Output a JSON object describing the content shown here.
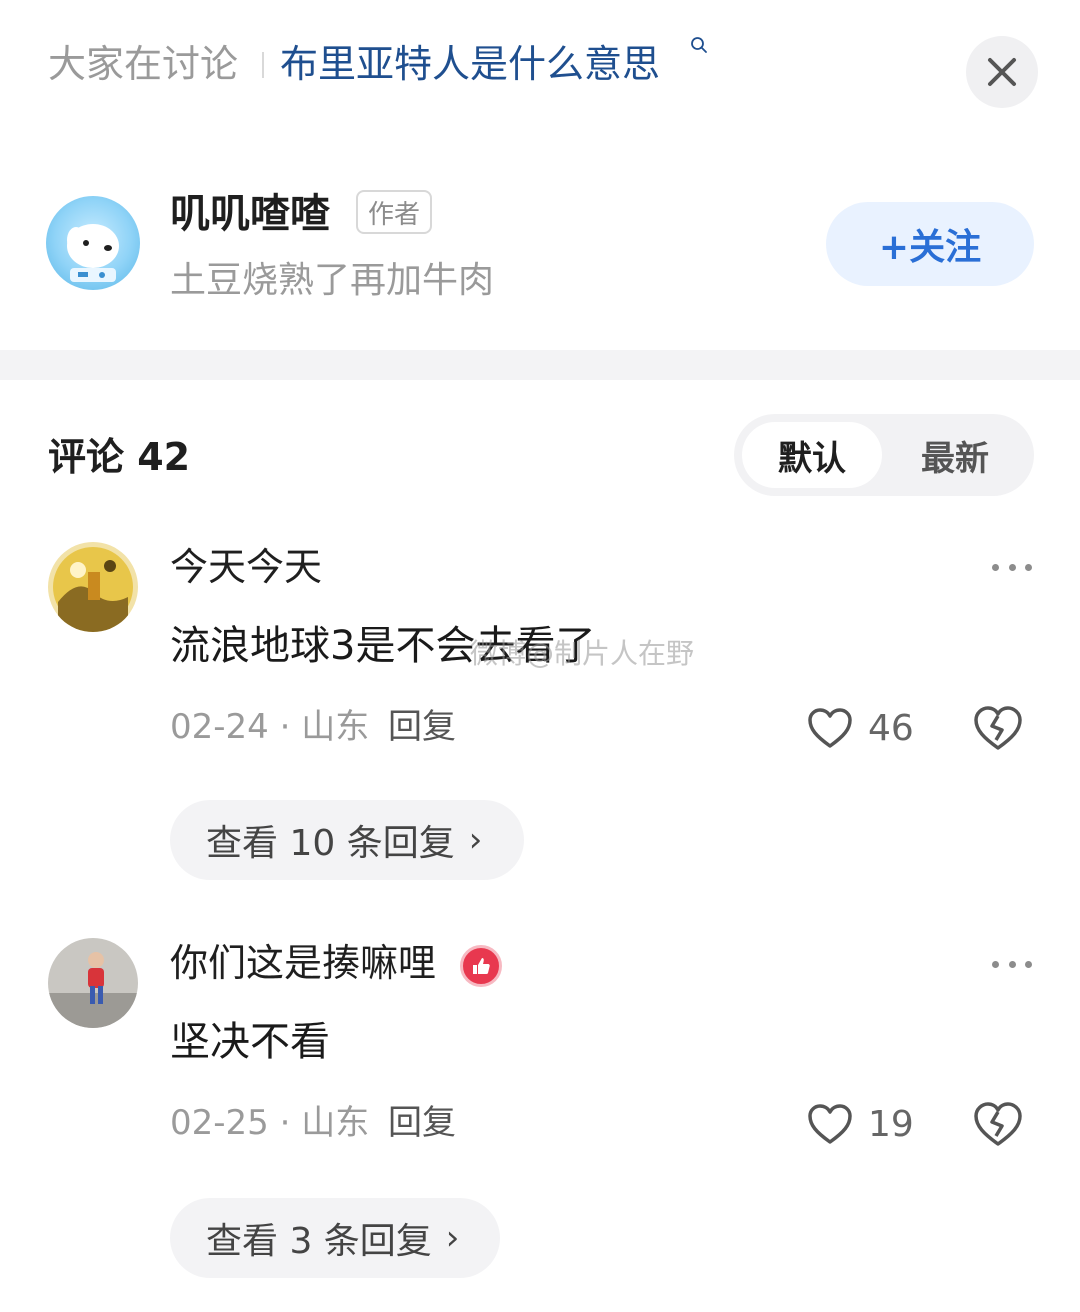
{
  "header": {
    "label": "大家在讨论",
    "topic": "布里亚特人是什么意思"
  },
  "author": {
    "name": "叽叽喳喳",
    "tag": "作者",
    "bio": "土豆烧熟了再加牛肉",
    "follow_label": "+关注"
  },
  "comments_section": {
    "title": "评论 42",
    "sort_default": "默认",
    "sort_latest": "最新"
  },
  "comments": [
    {
      "user": "今天今天",
      "text": "流浪地球3是不会去看了",
      "date": "02-24",
      "location": "山东",
      "reply_label": "回复",
      "likes": "46",
      "view_replies": "查看 10 条回复"
    },
    {
      "user": "你们这是揍嘛哩",
      "text": "坚决不看",
      "date": "02-25",
      "location": "山东",
      "reply_label": "回复",
      "likes": "19",
      "view_replies": "查看 3 条回复"
    }
  ],
  "watermark": "微博@制片人在野",
  "colors": {
    "topic_blue": "#1f4f8f",
    "follow_blue": "#2a6fd6",
    "badge_red": "#e8384f"
  }
}
